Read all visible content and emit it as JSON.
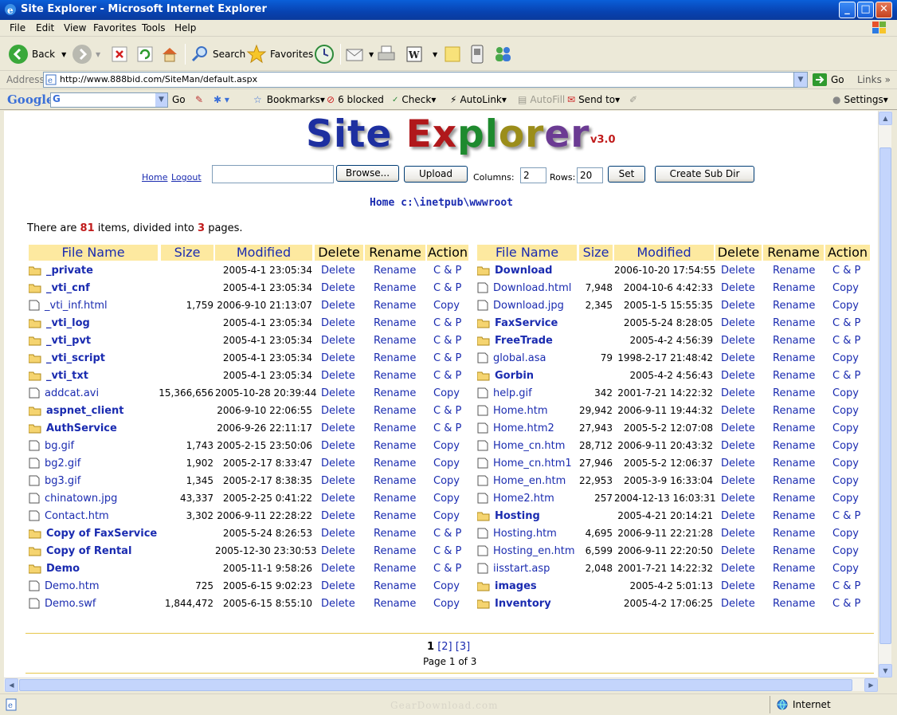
{
  "window": {
    "title": "Site Explorer - Microsoft Internet Explorer"
  },
  "menu": [
    "File",
    "Edit",
    "View",
    "Favorites",
    "Tools",
    "Help"
  ],
  "toolbar": {
    "back": "Back",
    "search": "Search",
    "favorites": "Favorites"
  },
  "address": {
    "label": "Address",
    "url": "http://www.888bid.com/SiteMan/default.aspx",
    "go": "Go",
    "links": "Links"
  },
  "google": {
    "logo": "Google",
    "go": "Go",
    "bookmarks": "Bookmarks",
    "blocked": "6 blocked",
    "check": "Check",
    "autolink": "AutoLink",
    "autofill": "AutoFill",
    "sendto": "Send to",
    "settings": "Settings"
  },
  "status": {
    "zone": "Internet",
    "watermark": "GearDownload.com"
  },
  "app": {
    "logo_parts": [
      "Site ",
      "Ex",
      "pl",
      "or",
      "er"
    ],
    "version": "v3.0",
    "home": "Home",
    "logout": "Logout",
    "browse": "Browse...",
    "upload": "Upload",
    "columns_label": "Columns:",
    "columns_value": "2",
    "rows_label": "Rows:",
    "rows_value": "20",
    "set": "Set",
    "create_sub_dir": "Create Sub Dir",
    "path": "Home c:\\inetpub\\wwwroot",
    "summary_pre": "There are ",
    "item_count": "81",
    "summary_mid": " items, divided into ",
    "page_count": "3",
    "summary_post": " pages.",
    "pager": {
      "current": "1",
      "p2": "[2]",
      "p3": "[3]",
      "page_of": "Page 1 of 3"
    }
  },
  "headers": {
    "name": "File Name",
    "size": "Size",
    "modified": "Modified",
    "delete": "Delete",
    "rename": "Rename",
    "action": "Action"
  },
  "labels": {
    "delete": "Delete",
    "rename": "Rename"
  },
  "files_left": [
    {
      "name": "_private",
      "dir": true,
      "size": "",
      "modified": "2005-4-1 23:05:34",
      "action": "C & P"
    },
    {
      "name": "_vti_cnf",
      "dir": true,
      "size": "",
      "modified": "2005-4-1 23:05:34",
      "action": "C & P"
    },
    {
      "name": "_vti_inf.html",
      "dir": false,
      "size": "1,759",
      "modified": "2006-9-10 21:13:07",
      "action": "Copy"
    },
    {
      "name": "_vti_log",
      "dir": true,
      "size": "",
      "modified": "2005-4-1 23:05:34",
      "action": "C & P"
    },
    {
      "name": "_vti_pvt",
      "dir": true,
      "size": "",
      "modified": "2005-4-1 23:05:34",
      "action": "C & P"
    },
    {
      "name": "_vti_script",
      "dir": true,
      "size": "",
      "modified": "2005-4-1 23:05:34",
      "action": "C & P"
    },
    {
      "name": "_vti_txt",
      "dir": true,
      "size": "",
      "modified": "2005-4-1 23:05:34",
      "action": "C & P"
    },
    {
      "name": "addcat.avi",
      "dir": false,
      "size": "15,366,656",
      "modified": "2005-10-28 20:39:44",
      "action": "Copy"
    },
    {
      "name": "aspnet_client",
      "dir": true,
      "size": "",
      "modified": "2006-9-10 22:06:55",
      "action": "C & P"
    },
    {
      "name": "AuthService",
      "dir": true,
      "size": "",
      "modified": "2006-9-26 22:11:17",
      "action": "C & P"
    },
    {
      "name": "bg.gif",
      "dir": false,
      "size": "1,743",
      "modified": "2005-2-15 23:50:06",
      "action": "Copy"
    },
    {
      "name": "bg2.gif",
      "dir": false,
      "size": "1,902",
      "modified": "2005-2-17 8:33:47",
      "action": "Copy"
    },
    {
      "name": "bg3.gif",
      "dir": false,
      "size": "1,345",
      "modified": "2005-2-17 8:38:35",
      "action": "Copy"
    },
    {
      "name": "chinatown.jpg",
      "dir": false,
      "size": "43,337",
      "modified": "2005-2-25 0:41:22",
      "action": "Copy"
    },
    {
      "name": "Contact.htm",
      "dir": false,
      "size": "3,302",
      "modified": "2006-9-11 22:28:22",
      "action": "Copy"
    },
    {
      "name": "Copy of FaxService",
      "dir": true,
      "size": "",
      "modified": "2005-5-24 8:26:53",
      "action": "C & P"
    },
    {
      "name": "Copy of Rental",
      "dir": true,
      "size": "",
      "modified": "2005-12-30 23:30:53",
      "action": "C & P"
    },
    {
      "name": "Demo",
      "dir": true,
      "size": "",
      "modified": "2005-11-1 9:58:26",
      "action": "C & P"
    },
    {
      "name": "Demo.htm",
      "dir": false,
      "size": "725",
      "modified": "2005-6-15 9:02:23",
      "action": "Copy"
    },
    {
      "name": "Demo.swf",
      "dir": false,
      "size": "1,844,472",
      "modified": "2005-6-15 8:55:10",
      "action": "Copy"
    }
  ],
  "files_right": [
    {
      "name": "Download",
      "dir": true,
      "size": "",
      "modified": "2006-10-20 17:54:55",
      "action": "C & P"
    },
    {
      "name": "Download.html",
      "dir": false,
      "size": "7,948",
      "modified": "2004-10-6 4:42:33",
      "action": "Copy"
    },
    {
      "name": "Download.jpg",
      "dir": false,
      "size": "2,345",
      "modified": "2005-1-5 15:55:35",
      "action": "Copy"
    },
    {
      "name": "FaxService",
      "dir": true,
      "size": "",
      "modified": "2005-5-24 8:28:05",
      "action": "C & P"
    },
    {
      "name": "FreeTrade",
      "dir": true,
      "size": "",
      "modified": "2005-4-2 4:56:39",
      "action": "C & P"
    },
    {
      "name": "global.asa",
      "dir": false,
      "size": "79",
      "modified": "1998-2-17 21:48:42",
      "action": "Copy"
    },
    {
      "name": "Gorbin",
      "dir": true,
      "size": "",
      "modified": "2005-4-2 4:56:43",
      "action": "C & P"
    },
    {
      "name": "help.gif",
      "dir": false,
      "size": "342",
      "modified": "2001-7-21 14:22:32",
      "action": "Copy"
    },
    {
      "name": "Home.htm",
      "dir": false,
      "size": "29,942",
      "modified": "2006-9-11 19:44:32",
      "action": "Copy"
    },
    {
      "name": "Home.htm2",
      "dir": false,
      "size": "27,943",
      "modified": "2005-5-2 12:07:08",
      "action": "Copy"
    },
    {
      "name": "Home_cn.htm",
      "dir": false,
      "size": "28,712",
      "modified": "2006-9-11 20:43:32",
      "action": "Copy"
    },
    {
      "name": "Home_cn.htm1",
      "dir": false,
      "size": "27,946",
      "modified": "2005-5-2 12:06:37",
      "action": "Copy"
    },
    {
      "name": "Home_en.htm",
      "dir": false,
      "size": "22,953",
      "modified": "2005-3-9 16:33:04",
      "action": "Copy"
    },
    {
      "name": "Home2.htm",
      "dir": false,
      "size": "257",
      "modified": "2004-12-13 16:03:31",
      "action": "Copy"
    },
    {
      "name": "Hosting",
      "dir": true,
      "size": "",
      "modified": "2005-4-21 20:14:21",
      "action": "C & P"
    },
    {
      "name": "Hosting.htm",
      "dir": false,
      "size": "4,695",
      "modified": "2006-9-11 22:21:28",
      "action": "Copy"
    },
    {
      "name": "Hosting_en.htm",
      "dir": false,
      "size": "6,599",
      "modified": "2006-9-11 22:20:50",
      "action": "Copy"
    },
    {
      "name": "iisstart.asp",
      "dir": false,
      "size": "2,048",
      "modified": "2001-7-21 14:22:32",
      "action": "Copy"
    },
    {
      "name": "images",
      "dir": true,
      "size": "",
      "modified": "2005-4-2 5:01:13",
      "action": "C & P"
    },
    {
      "name": "Inventory",
      "dir": true,
      "size": "",
      "modified": "2005-4-2 17:06:25",
      "action": "C & P"
    }
  ]
}
